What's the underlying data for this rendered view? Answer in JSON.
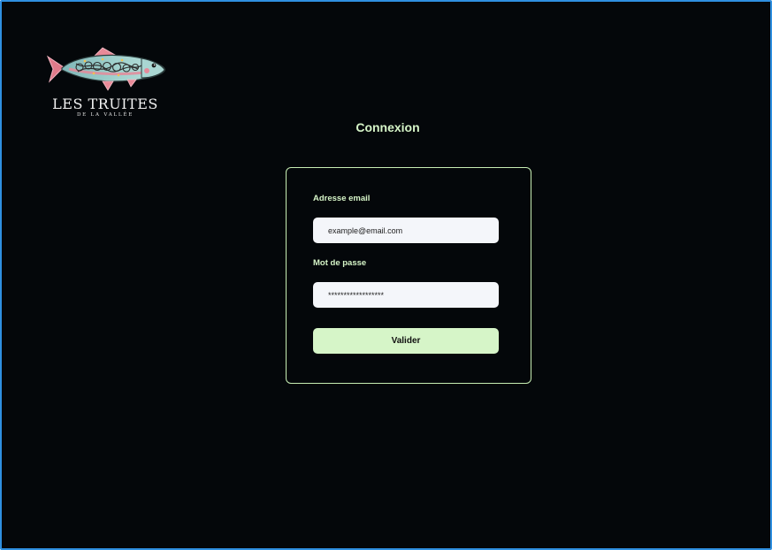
{
  "brand": {
    "title": "LES TRUITES",
    "subtitle": "DE LA VALLÉE"
  },
  "page": {
    "title": "Connexion"
  },
  "form": {
    "email_label": "Adresse email",
    "email_value": "example@email.com",
    "password_label": "Mot de passe",
    "password_value": "******************",
    "submit_label": "Valider"
  },
  "colors": {
    "background": "#04070a",
    "accent": "#d6f5c8",
    "frame": "#2f8fe0",
    "input_bg": "#f4f6fa"
  },
  "icons": {
    "logo": "trout-fish-icon"
  }
}
